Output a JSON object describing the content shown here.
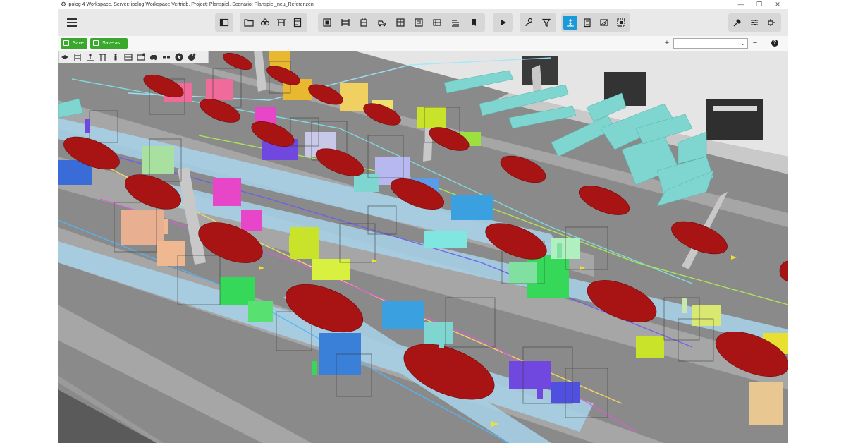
{
  "window": {
    "title": "ipolog 4 Workspace, Server: ipolog Workspace Vertrieb, Project: Planspiel, Scenario: Planspiel_neu_Referenzen",
    "logo_icon": "ipolog-logo-icon",
    "controls": [
      "minimize-icon",
      "restore-icon",
      "close-icon"
    ]
  },
  "toolbar": {
    "menu_icon": "hamburger-menu-icon",
    "groups": [
      {
        "name": "panel",
        "icons": [
          "panel-toggle-icon"
        ]
      },
      {
        "name": "file",
        "icons": [
          "open-folder-icon",
          "scenario-icon",
          "layout-icon",
          "report-icon"
        ]
      },
      {
        "name": "objects",
        "icons": [
          "frame-icon",
          "rack-icon",
          "container-icon",
          "vehicle-icon",
          "shelf-icon",
          "station-icon",
          "line-icon",
          "stack-icon",
          "bookmark-icon"
        ]
      },
      {
        "name": "simulation",
        "icons": [
          "play-icon"
        ]
      },
      {
        "name": "analysis",
        "icons": [
          "route-icon",
          "filter-icon"
        ]
      },
      {
        "name": "view",
        "icons": [
          "path-icon",
          "clipboard-icon",
          "heatmap-icon",
          "select-area-icon"
        ],
        "active_index": 0
      },
      {
        "name": "settings",
        "icons": [
          "plugin-icon",
          "sliders-icon",
          "connection-icon"
        ]
      }
    ],
    "accent_color": "#1a9ad6"
  },
  "actionbar": {
    "save_label": "Save",
    "save_as_label": "Save as...",
    "save_color": "#3aa82c",
    "zoom_value": "",
    "zoom_plus": "+",
    "zoom_minus": "−",
    "help_label": "?"
  },
  "viewport_tools": [
    "layers-icon",
    "rack-tool-icon",
    "worker-tool-icon",
    "frame-tool-icon",
    "person-tool-icon",
    "shelf-tool-icon",
    "shelf-badge-tool-icon",
    "car-tool-icon",
    "link-tool-icon",
    "cursor-tool-icon",
    "globe-badge-tool-icon"
  ],
  "scene": {
    "floor_color": "#8c8c8c",
    "lane_color": "#a9a9a9",
    "path_color": "#a8d8ef",
    "car_color": "#a81414",
    "rack_colors": [
      "#7fd6d0",
      "#c9e22a",
      "#3aa0e0",
      "#e846c8",
      "#36d85a",
      "#7048e0",
      "#e8b830"
    ]
  }
}
